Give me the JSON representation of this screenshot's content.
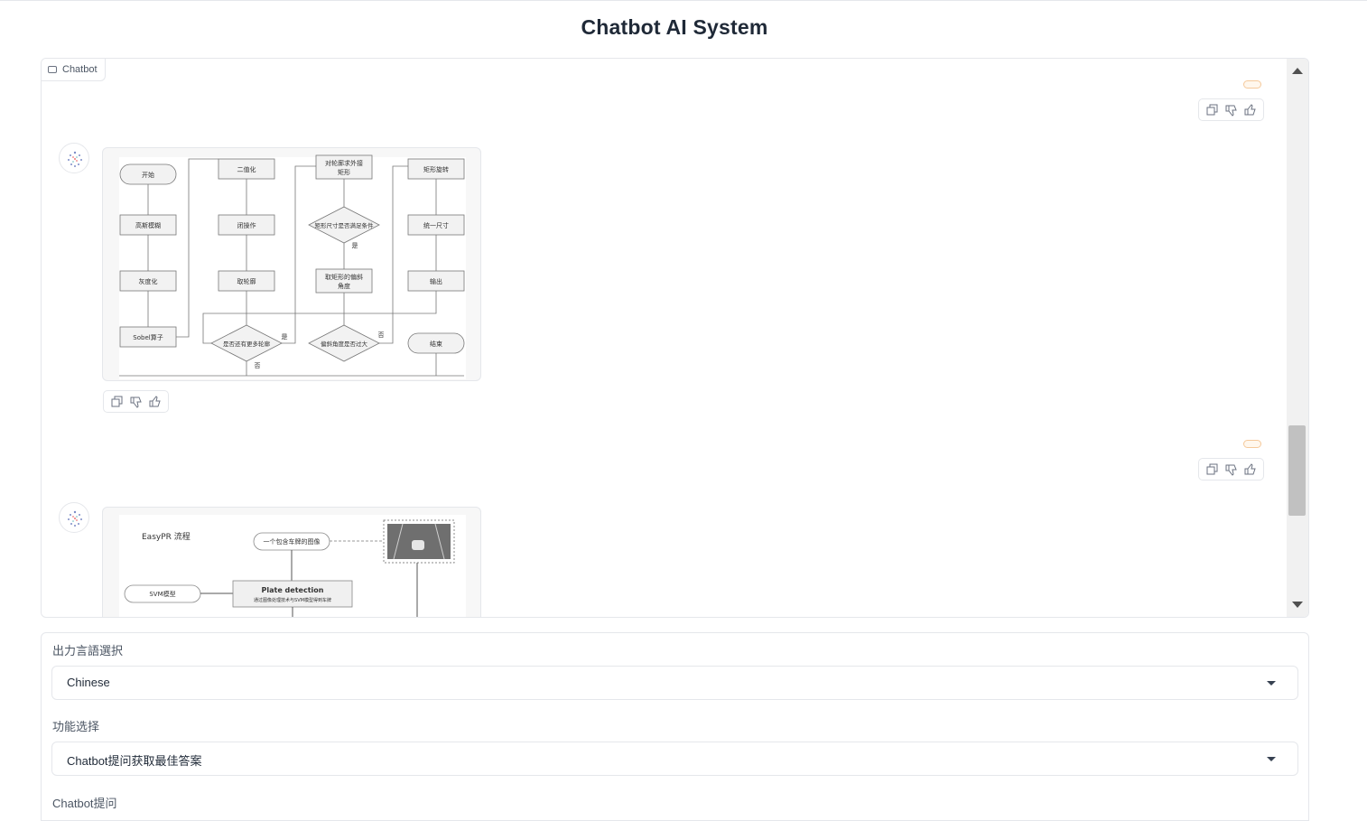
{
  "app": {
    "title": "Chatbot AI System"
  },
  "chatbot": {
    "label": "Chatbot",
    "icon": "chat-bubble-icon",
    "action_icons": [
      "copy-icon",
      "thumbs-down-icon",
      "thumbs-up-icon"
    ]
  },
  "flowchart1": {
    "nodes": {
      "start": "开始",
      "blur": "高斯模糊",
      "gray": "灰度化",
      "sobel": "Sobel算子",
      "binarize": "二值化",
      "close": "闭操作",
      "contour": "取轮廓",
      "more": "是否还有更多轮廓",
      "rect_a": "对轮廓求外接",
      "rect_b": "矩形",
      "size_q": "矩形尺寸是否满足条件",
      "angle_a": "取矩形的偏斜",
      "angle_b": "角度",
      "skew_q": "偏斜角度是否过大",
      "rotate": "矩形旋转",
      "resize": "统一尺寸",
      "output": "输出",
      "end": "结束",
      "yes": "是",
      "no": "否"
    }
  },
  "flowchart2": {
    "title": "EasyPR 流程",
    "input_image": "一个包含车牌的图像",
    "svm": "SVM模型",
    "plate_title": "Plate detection",
    "plate_sub": "通过图像处理技术与SVM模型得到车牌"
  },
  "language": {
    "label": "出力言語選択",
    "value": "Chinese"
  },
  "function": {
    "label": "功能选择",
    "value": "Chatbot提问获取最佳答案"
  },
  "question": {
    "label": "Chatbot提问"
  }
}
